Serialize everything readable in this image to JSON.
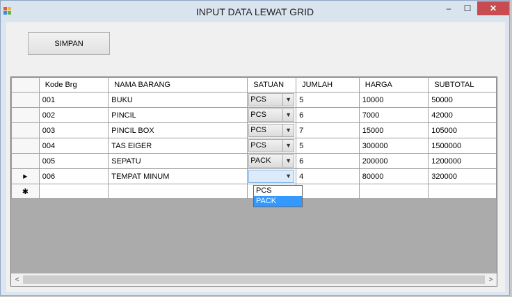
{
  "window": {
    "title": "INPUT DATA LEWAT GRID"
  },
  "titlebar_buttons": {
    "minimize": "–",
    "maximize": "☐",
    "close": "✕"
  },
  "toolbar": {
    "simpan_label": "SIMPAN"
  },
  "grid": {
    "columns": [
      "Kode Brg",
      "NAMA BARANG",
      "SATUAN",
      "JUMLAH",
      "HARGA",
      "SUBTOTAL"
    ],
    "rows": [
      {
        "kode": "001",
        "nama": "BUKU",
        "satuan": "PCS",
        "jumlah": "5",
        "harga": "10000",
        "subtotal": "50000"
      },
      {
        "kode": "002",
        "nama": "PINCIL",
        "satuan": "PCS",
        "jumlah": "6",
        "harga": "7000",
        "subtotal": "42000"
      },
      {
        "kode": "003",
        "nama": "PINCIL BOX",
        "satuan": "PCS",
        "jumlah": "7",
        "harga": "15000",
        "subtotal": "105000"
      },
      {
        "kode": "004",
        "nama": "TAS EIGER",
        "satuan": "PCS",
        "jumlah": "5",
        "harga": "300000",
        "subtotal": "1500000"
      },
      {
        "kode": "005",
        "nama": "SEPATU",
        "satuan": "PACK",
        "jumlah": "6",
        "harga": "200000",
        "subtotal": "1200000"
      },
      {
        "kode": "006",
        "nama": "TEMPAT MINUM",
        "satuan": "",
        "jumlah": "4",
        "harga": "80000",
        "subtotal": "320000"
      }
    ],
    "current_row_marker": "▶",
    "new_row_marker": "✱",
    "dropdown_options": [
      "PCS",
      "PACK"
    ],
    "dropdown_highlighted": "PACK"
  },
  "scrollbar": {
    "left_arrow": "<",
    "right_arrow": ">"
  },
  "icons": {
    "app": "form-app-icon",
    "combo_arrow": "chevron-down-icon"
  },
  "colors": {
    "title_bar": "#dae4ef",
    "close_button": "#c74b50",
    "selection": "#3399ff",
    "grid_empty": "#ababab"
  }
}
